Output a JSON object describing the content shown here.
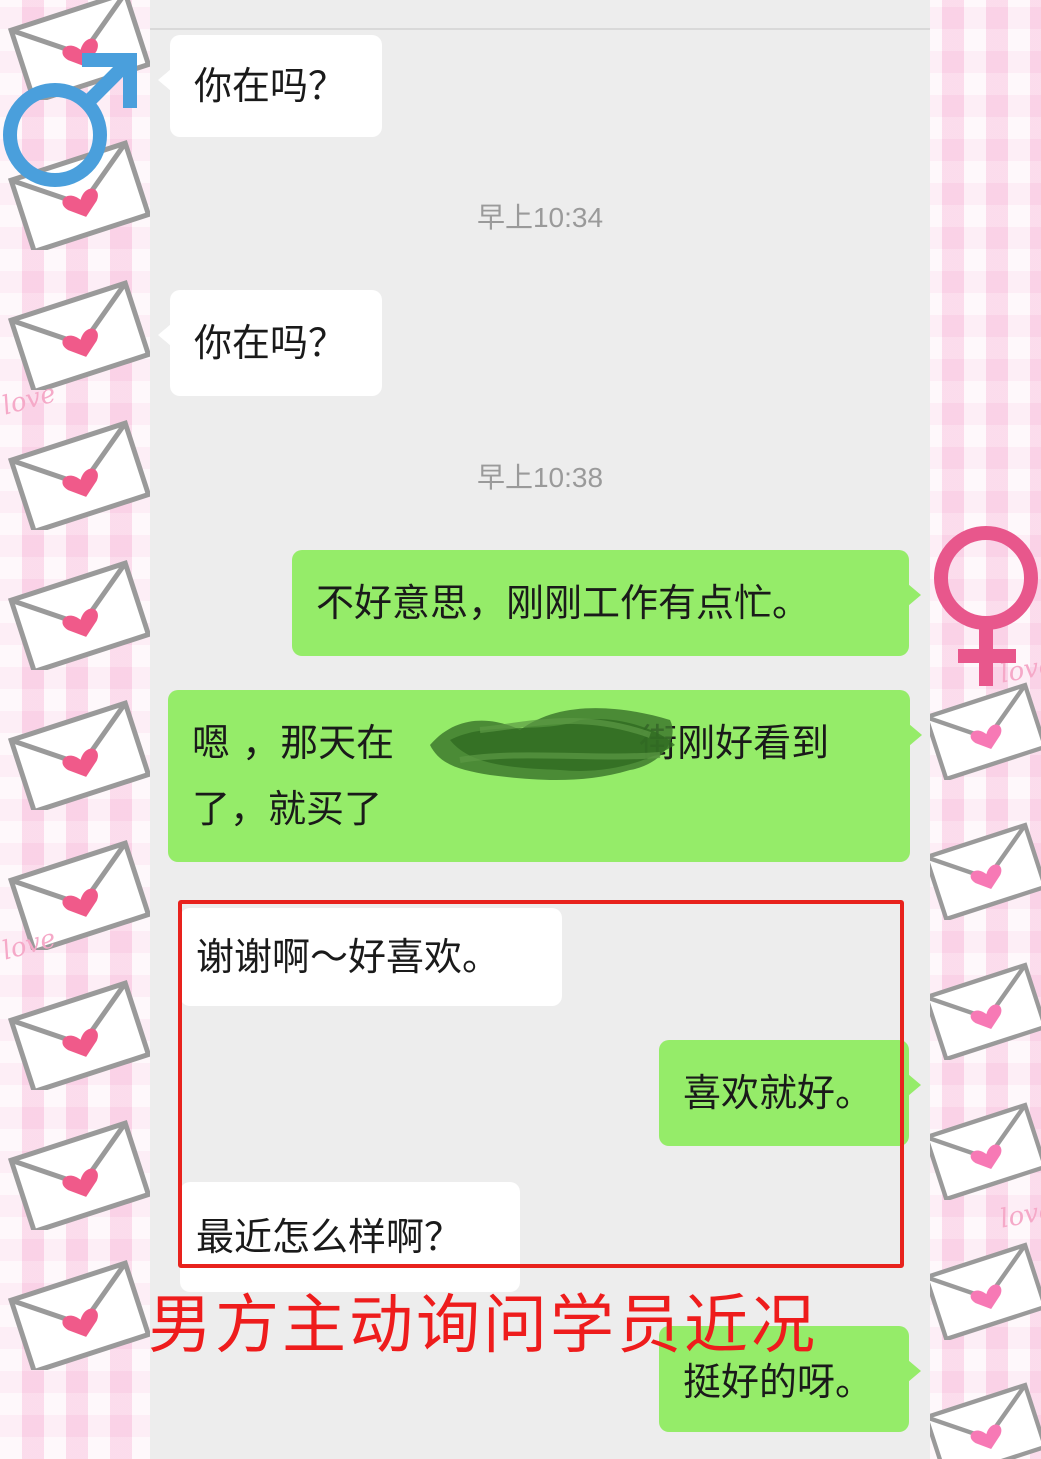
{
  "messages": [
    {
      "id": "m1",
      "side": "in",
      "text": "你在吗？"
    },
    {
      "id": "t1",
      "type": "timestamp",
      "text": "早上10:34"
    },
    {
      "id": "m2",
      "side": "in",
      "text": "你在吗？"
    },
    {
      "id": "t2",
      "type": "timestamp",
      "text": "早上10:38"
    },
    {
      "id": "m3",
      "side": "out",
      "text": "不好意思，刚刚工作有点忙。"
    },
    {
      "id": "m4",
      "side": "out",
      "line1_before": "嗯 ，那天在",
      "line1_after": "街刚好看到",
      "line2": "了，就买了"
    },
    {
      "id": "m5",
      "side": "in",
      "text": "谢谢啊～好喜欢。"
    },
    {
      "id": "m6",
      "side": "out",
      "text": "喜欢就好。"
    },
    {
      "id": "m7",
      "side": "in",
      "text": "最近怎么样啊？"
    },
    {
      "id": "m8",
      "side": "out",
      "text": "挺好的呀。"
    }
  ],
  "caption": "男方主动询问学员近况",
  "decor": {
    "male_symbol": "♂",
    "female_symbol": "♀",
    "love_text": "love",
    "colors": {
      "male": "#4a9fdc",
      "female": "#e8578c",
      "outgoing_bubble": "#95ec69",
      "incoming_bubble": "#ffffff",
      "highlight": "#e8221d",
      "caption": "#ee1c1c"
    },
    "icons": [
      "male-symbol-icon",
      "female-symbol-icon",
      "envelope-heart-icon",
      "redaction-scribble"
    ]
  }
}
